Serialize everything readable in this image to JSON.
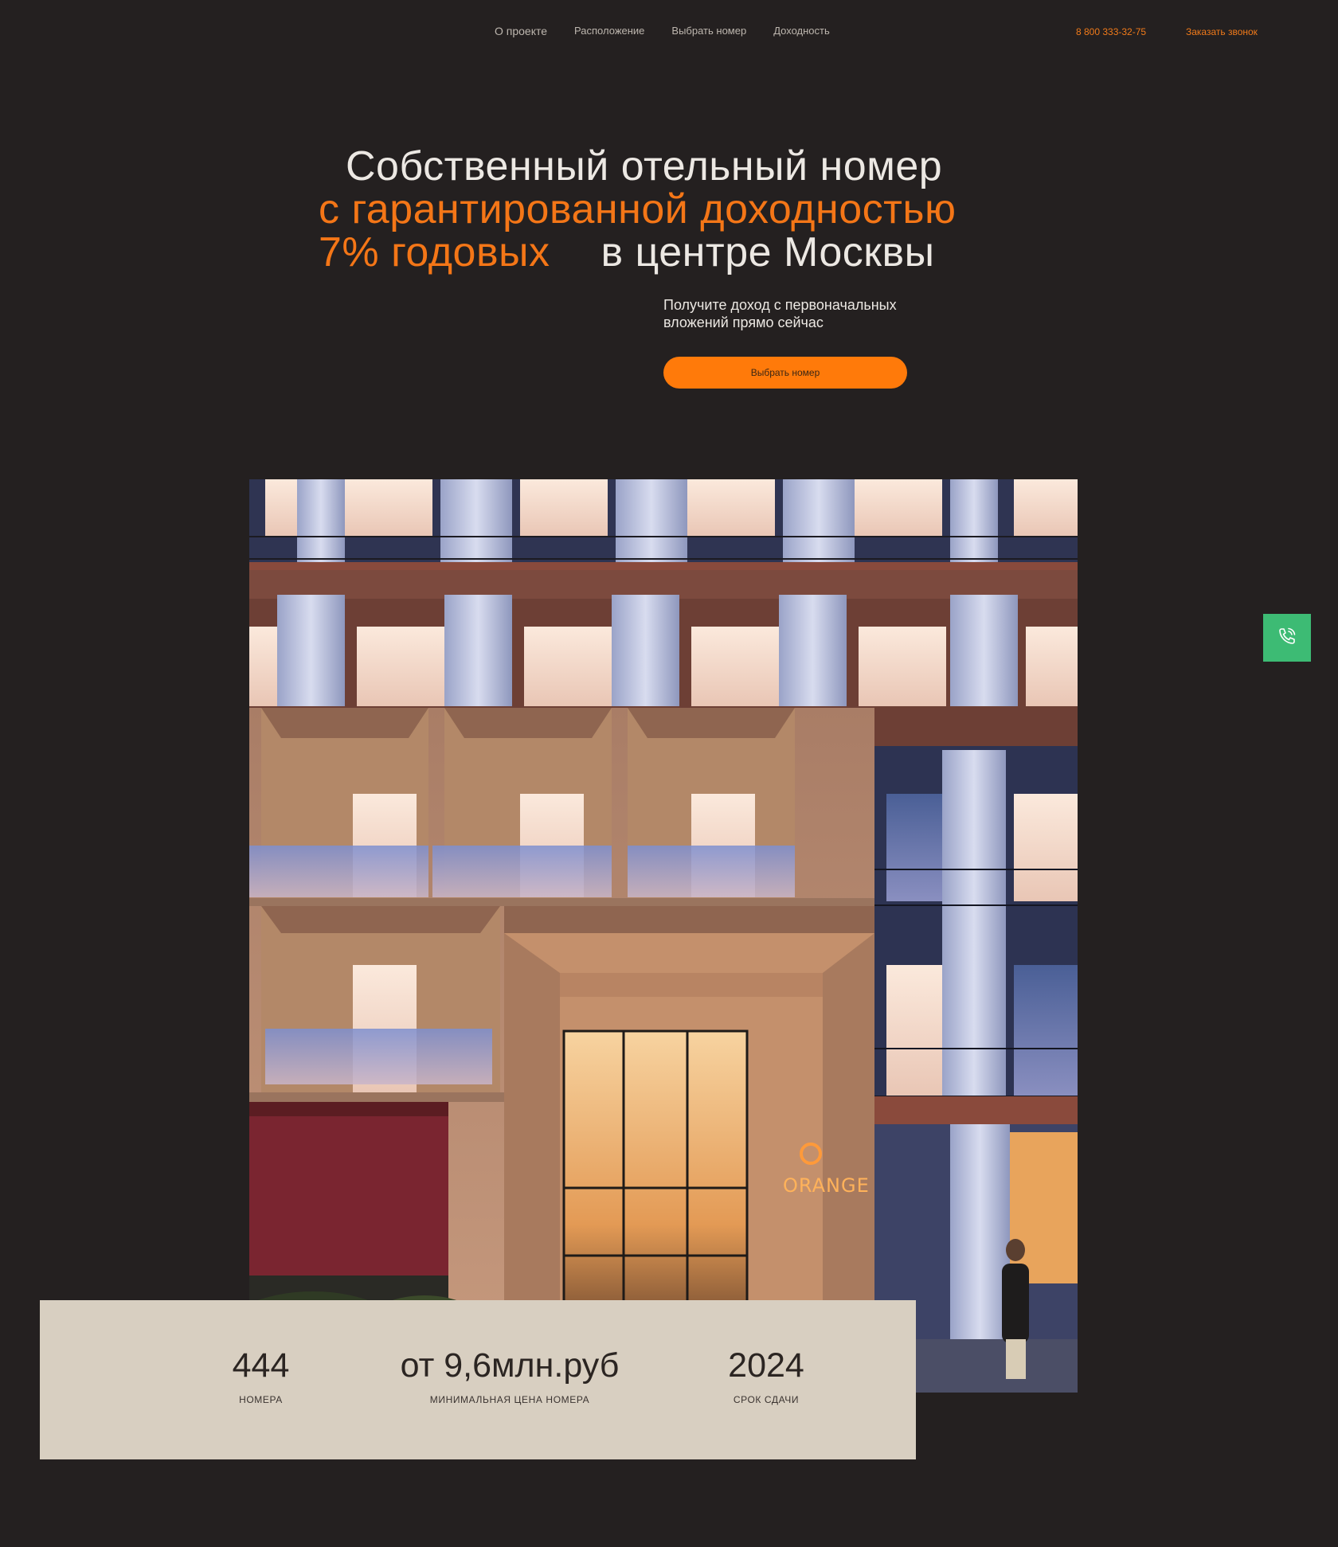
{
  "nav": {
    "links": [
      "О проекте",
      "Расположение",
      "Выбрать номер",
      "Доходность"
    ],
    "phone": "8 800 333-32-75",
    "callback": "Заказать звонок"
  },
  "hero": {
    "title_line1": "Собственный отельный номер",
    "title_line2": "с гарантированной доходностью",
    "title_line3_orange": "7% годовых",
    "title_line3_white": "в центре Москвы",
    "subtitle": "Получите доход с первоначальных вложений прямо сейчас",
    "cta_label": "Выбрать номер"
  },
  "building": {
    "sign": "ORANGE"
  },
  "stats": [
    {
      "value": "444",
      "label": "НОМЕРА"
    },
    {
      "value": "от 9,6млн.руб",
      "label": "МИНИМАЛЬНАЯ ЦЕНА НОМЕРА"
    },
    {
      "value": "2024",
      "label": "СРОК СДАЧИ"
    }
  ],
  "colors": {
    "background": "#242020",
    "accent": "#f47617",
    "cta": "#ff7a0a",
    "call_button": "#3dbb74",
    "stats_panel": "#d8cfc1"
  },
  "icons": {
    "call_fab": "phone-icon"
  }
}
